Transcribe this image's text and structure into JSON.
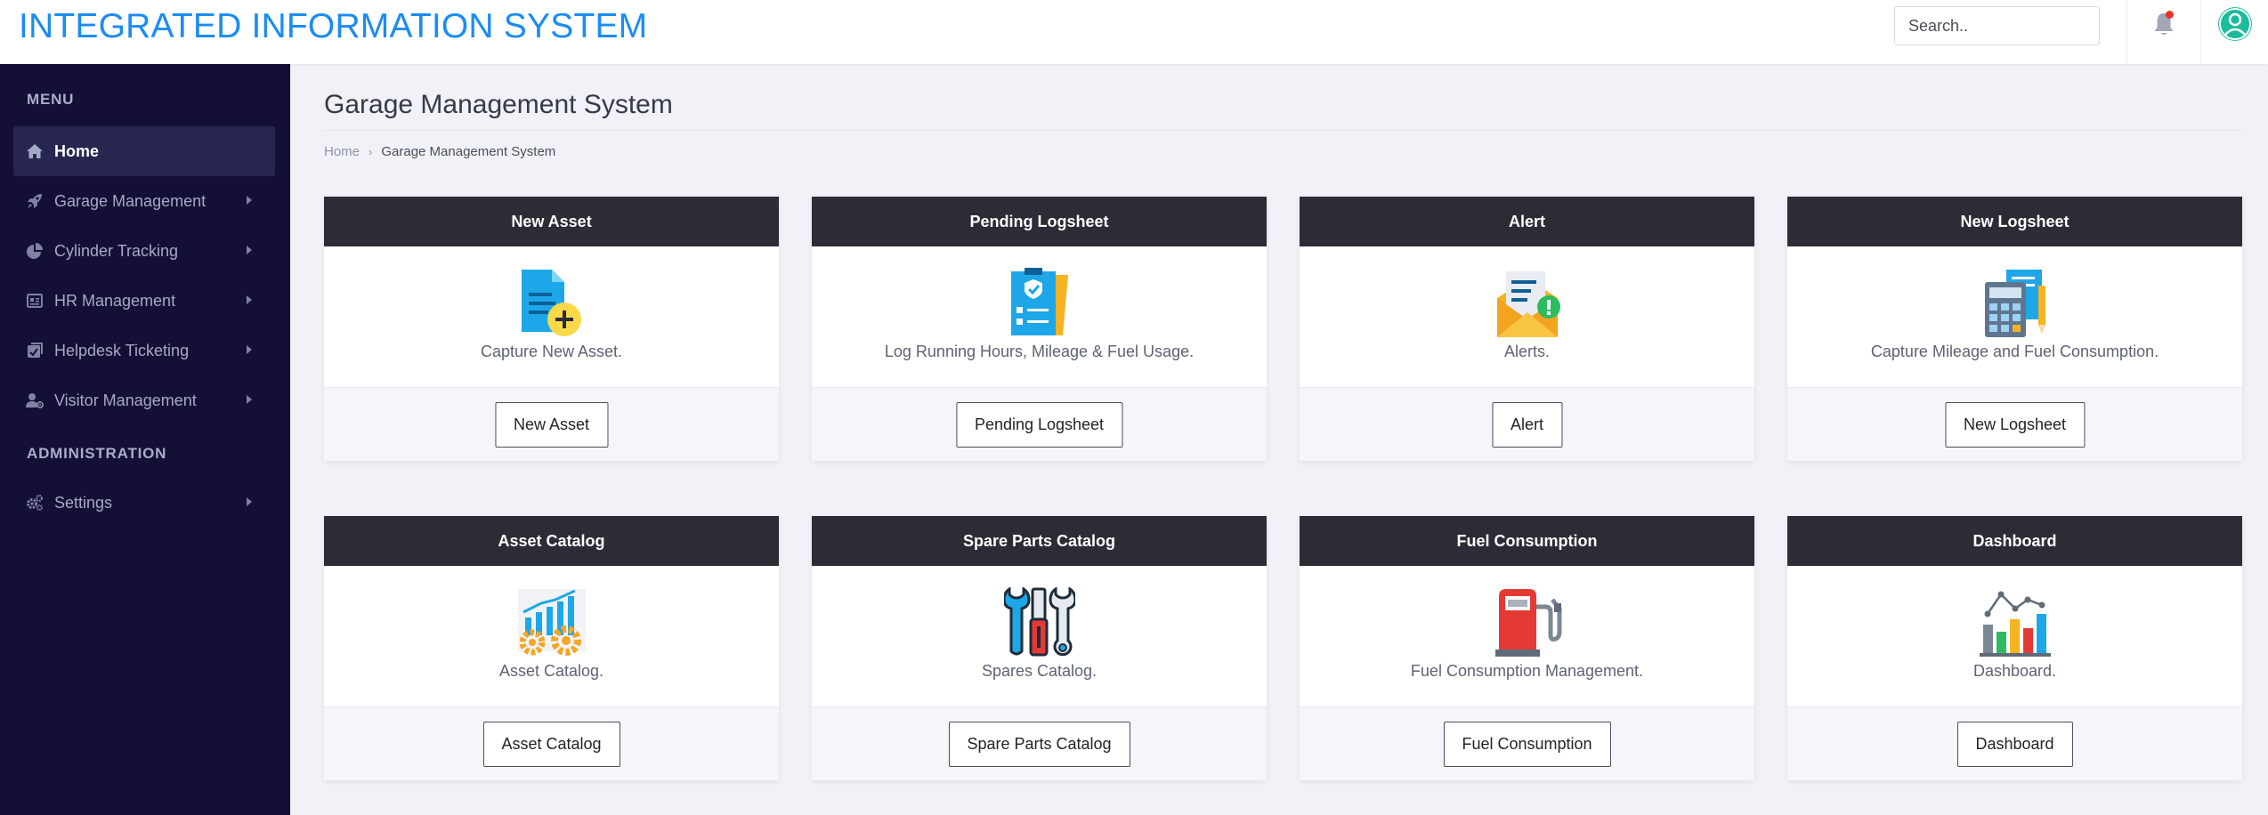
{
  "header": {
    "brand": "INTEGRATED INFORMATION SYSTEM",
    "search_placeholder": "Search.."
  },
  "sidebar": {
    "menu_title": "MENU",
    "admin_title": "ADMINISTRATION",
    "items": [
      {
        "label": "Home",
        "icon": "home-icon"
      },
      {
        "label": "Garage Management",
        "icon": "rocket-icon"
      },
      {
        "label": "Cylinder Tracking",
        "icon": "pie-chart-icon"
      },
      {
        "label": "HR Management",
        "icon": "id-card-icon"
      },
      {
        "label": "Helpdesk Ticketing",
        "icon": "ticket-icon"
      },
      {
        "label": "Visitor Management",
        "icon": "user-gear-icon"
      }
    ],
    "admin_items": [
      {
        "label": "Settings",
        "icon": "gears-icon"
      }
    ]
  },
  "main": {
    "title": "Garage Management System",
    "breadcrumb": {
      "home": "Home",
      "current": "Garage Management System"
    },
    "cards": [
      {
        "title": "New Asset",
        "text": "Capture New Asset.",
        "button": "New Asset",
        "icon": "new-document-icon"
      },
      {
        "title": "Pending Logsheet",
        "text": "Log Running Hours, Mileage & Fuel Usage.",
        "button": "Pending Logsheet",
        "icon": "checklist-icon"
      },
      {
        "title": "Alert",
        "text": "Alerts.",
        "button": "Alert",
        "icon": "mail-alert-icon"
      },
      {
        "title": "New Logsheet",
        "text": "Capture Mileage and Fuel Consumption.",
        "button": "New Logsheet",
        "icon": "calculator-icon"
      },
      {
        "title": "Asset Catalog",
        "text": "Asset Catalog.",
        "button": "Asset Catalog",
        "icon": "chart-gears-icon"
      },
      {
        "title": "Spare Parts Catalog",
        "text": "Spares Catalog.",
        "button": "Spare Parts Catalog",
        "icon": "tools-icon"
      },
      {
        "title": "Fuel Consumption",
        "text": "Fuel Consumption Management.",
        "button": "Fuel Consumption",
        "icon": "fuel-pump-icon"
      },
      {
        "title": "Dashboard",
        "text": "Dashboard.",
        "button": "Dashboard",
        "icon": "bar-chart-icon"
      }
    ]
  },
  "colors": {
    "brand": "#1b8cf2",
    "sidebar": "#130f35",
    "card_header": "#2b2c35",
    "avatar": "#1abc9c",
    "notification_dot": "#e8332a"
  }
}
